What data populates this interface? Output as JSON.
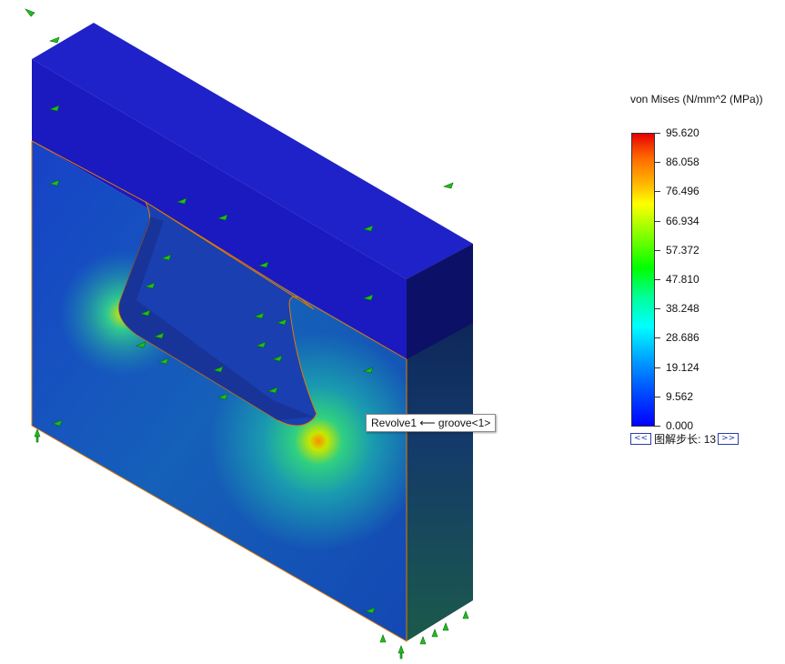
{
  "legend": {
    "title": "von Mises (N/mm^2 (MPa))",
    "ticks": [
      "95.620",
      "86.058",
      "76.496",
      "66.934",
      "57.372",
      "47.810",
      "38.248",
      "28.686",
      "19.124",
      "9.562",
      "0.000"
    ],
    "stepper": {
      "prev_label": "<<",
      "text": "图解步长: 13",
      "next_label": ">>"
    }
  },
  "tooltip": {
    "text": "Revolve1 ⟵ groove<1>"
  },
  "model": {
    "colormap": "jet",
    "max_color": "#e60000",
    "min_color": "#0000ff",
    "load_arrow_color": "#1ebe1e",
    "edge_color": "#e07a00"
  }
}
